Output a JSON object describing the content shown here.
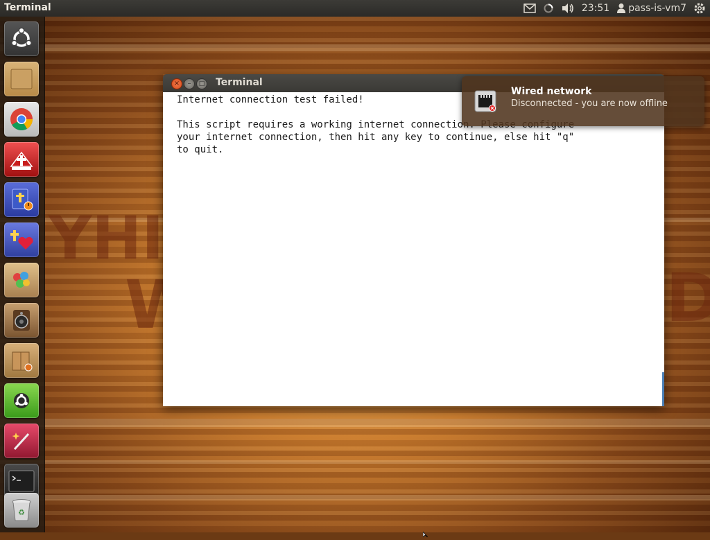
{
  "top_panel": {
    "app_title": "Terminal",
    "clock": "23:51",
    "username": "pass-is-vm7",
    "icons": [
      "mail-icon",
      "network-busy-icon",
      "volume-icon",
      "user-icon",
      "gear-icon"
    ]
  },
  "launcher": {
    "items": [
      {
        "name": "dash-home",
        "icon": "ubuntu-logo-icon"
      },
      {
        "name": "files",
        "icon": "folder-icon"
      },
      {
        "name": "chrome",
        "icon": "chrome-icon"
      },
      {
        "name": "bible-app",
        "icon": "bible-book-icon"
      },
      {
        "name": "bible-study",
        "icon": "bible-clock-icon"
      },
      {
        "name": "christian-app",
        "icon": "cross-heart-icon"
      },
      {
        "name": "paint",
        "icon": "paint-icon"
      },
      {
        "name": "audio",
        "icon": "speaker-icon"
      },
      {
        "name": "package-installer",
        "icon": "package-icon"
      },
      {
        "name": "software-center",
        "icon": "ubuntu-software-icon"
      },
      {
        "name": "wand",
        "icon": "magic-wand-icon"
      },
      {
        "name": "terminal",
        "icon": "terminal-icon"
      },
      {
        "name": "trash",
        "icon": "trash-icon"
      }
    ]
  },
  "terminal": {
    "title": "Terminal",
    "output": "Internet connection test failed!\n\nThis script requires a working internet connection. Please configure\nyour internet connection, then hit any key to continue, else hit \"q\"\nto quit."
  },
  "notification": {
    "title": "Wired network",
    "body": "Disconnected - you are now offline",
    "icon": "wired-network-disconnected-icon"
  },
  "colors": {
    "panel": "#3c3b37",
    "accent_close": "#e95420",
    "terminal_bg": "#ffffff"
  }
}
